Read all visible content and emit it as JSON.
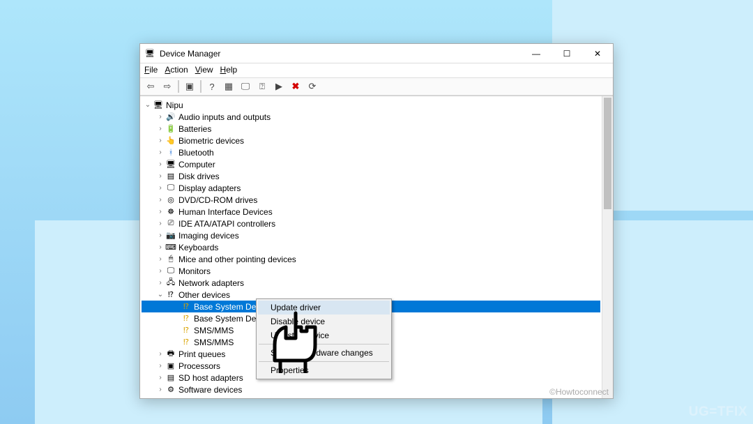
{
  "window": {
    "title": "Device Manager",
    "buttons": {
      "min": "—",
      "max": "☐",
      "close": "✕"
    }
  },
  "menu": [
    "File",
    "Action",
    "View",
    "Help"
  ],
  "toolbar": [
    {
      "name": "back-icon",
      "glyph": "⇦"
    },
    {
      "name": "forward-icon",
      "glyph": "⇨"
    },
    {
      "name": "sep"
    },
    {
      "name": "show-hide-icon",
      "glyph": "▣"
    },
    {
      "name": "sep"
    },
    {
      "name": "help-icon",
      "glyph": "?"
    },
    {
      "name": "refresh-icon",
      "glyph": "▦"
    },
    {
      "name": "monitor-icon",
      "glyph": "🖵"
    },
    {
      "name": "update-icon",
      "glyph": "⍰"
    },
    {
      "name": "enable-icon",
      "glyph": "▶"
    },
    {
      "name": "uninstall-icon",
      "glyph": "✖",
      "cls": "red"
    },
    {
      "name": "scan-icon",
      "glyph": "⟳"
    }
  ],
  "tree": {
    "root": "Nipu",
    "items": [
      {
        "label": "Audio inputs and outputs",
        "icon": "🔊"
      },
      {
        "label": "Batteries",
        "icon": "🔋"
      },
      {
        "label": "Biometric devices",
        "icon": "👆"
      },
      {
        "label": "Bluetooth",
        "icon": "ᚼ",
        "color": "#1e6fd8"
      },
      {
        "label": "Computer",
        "icon": "🖥"
      },
      {
        "label": "Disk drives",
        "icon": "▤"
      },
      {
        "label": "Display adapters",
        "icon": "🖵"
      },
      {
        "label": "DVD/CD-ROM drives",
        "icon": "◎"
      },
      {
        "label": "Human Interface Devices",
        "icon": "☸"
      },
      {
        "label": "IDE ATA/ATAPI controllers",
        "icon": "⎚"
      },
      {
        "label": "Imaging devices",
        "icon": "📷"
      },
      {
        "label": "Keyboards",
        "icon": "⌨"
      },
      {
        "label": "Mice and other pointing devices",
        "icon": "🖱"
      },
      {
        "label": "Monitors",
        "icon": "🖵"
      },
      {
        "label": "Network adapters",
        "icon": "🖧"
      }
    ],
    "expanded": {
      "label": "Other devices",
      "icon": "⁉",
      "children": [
        {
          "label": "Base System Device",
          "selected": true
        },
        {
          "label": "Base System Device"
        },
        {
          "label": "SMS/MMS"
        },
        {
          "label": "SMS/MMS"
        }
      ]
    },
    "rest": [
      {
        "label": "Print queues",
        "icon": "🖶"
      },
      {
        "label": "Processors",
        "icon": "▣"
      },
      {
        "label": "SD host adapters",
        "icon": "▤"
      },
      {
        "label": "Software devices",
        "icon": "⚙"
      }
    ]
  },
  "context": {
    "items": [
      "Update driver",
      "Disable device",
      "Uninstall device",
      "-",
      "Scan for hardware changes",
      "-",
      "Properties"
    ]
  },
  "watermark": "©Howtoconnect",
  "brand": "UG=TFIX"
}
